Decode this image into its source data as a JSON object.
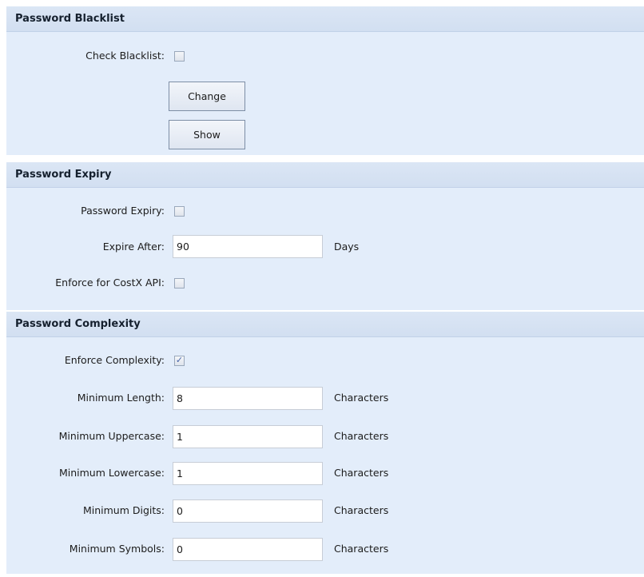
{
  "blacklist": {
    "title": "Password Blacklist",
    "check_label": "Check Blacklist:",
    "check_checked": false,
    "change_button": "Change",
    "show_button": "Show"
  },
  "expiry": {
    "title": "Password Expiry",
    "expiry_label": "Password Expiry:",
    "expiry_checked": false,
    "expire_after_label": "Expire After:",
    "expire_after_value": "90",
    "expire_after_unit": "Days",
    "enforce_api_label": "Enforce for CostX API:",
    "enforce_api_checked": false
  },
  "complexity": {
    "title": "Password Complexity",
    "enforce_label": "Enforce Complexity:",
    "enforce_checked": true,
    "check_glyph": "✓",
    "unit": "Characters",
    "fields": [
      {
        "label": "Minimum Length:",
        "value": "8"
      },
      {
        "label": "Minimum Uppercase:",
        "value": "1"
      },
      {
        "label": "Minimum Lowercase:",
        "value": "1"
      },
      {
        "label": "Minimum Digits:",
        "value": "0"
      },
      {
        "label": "Minimum Symbols:",
        "value": "0"
      }
    ]
  }
}
